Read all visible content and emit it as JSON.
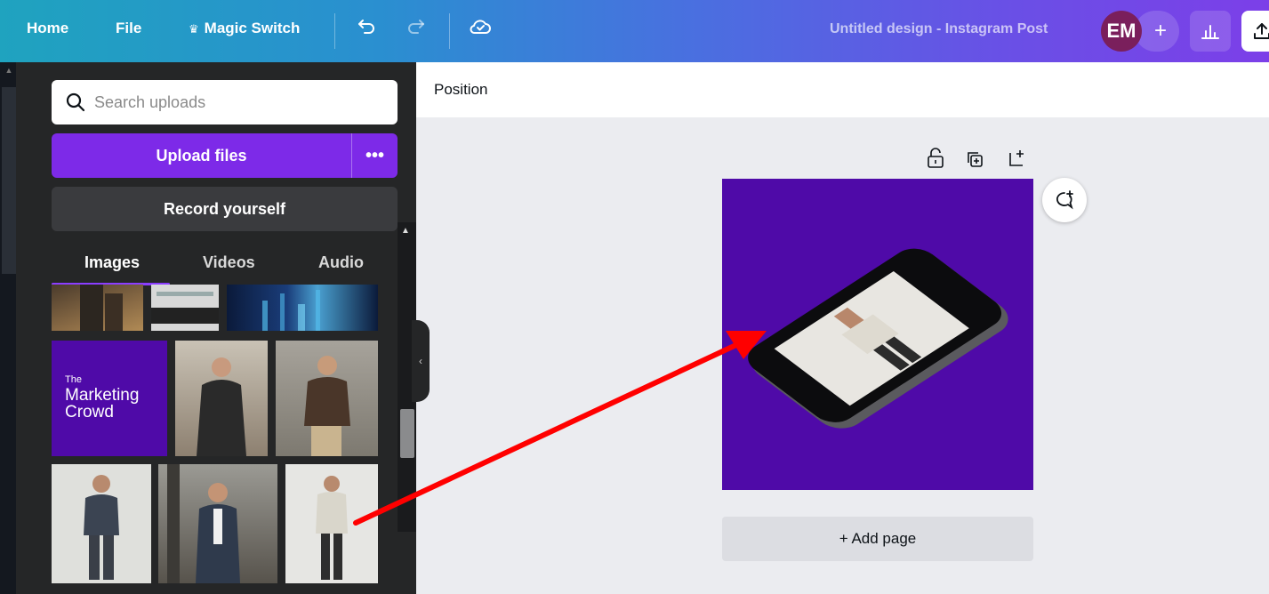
{
  "topbar": {
    "home": "Home",
    "file": "File",
    "magic_switch": "Magic Switch",
    "magic_icon": "crown-icon",
    "undo_icon": "undo-icon",
    "redo_icon": "redo-icon",
    "cloud_icon": "cloud-saved-icon",
    "design_title": "Untitled design - Instagram Post",
    "avatar_initials": "EM",
    "avatar_add": "+"
  },
  "panel": {
    "search_placeholder": "Search uploads",
    "upload_label": "Upload files",
    "upload_more": "•••",
    "record_label": "Record yourself",
    "tabs": [
      {
        "label": "Images",
        "active": true
      },
      {
        "label": "Videos",
        "active": false
      },
      {
        "label": "Audio",
        "active": false
      }
    ],
    "marketing_tile": {
      "line1": "The",
      "line2": "Marketing",
      "line3": "Crowd"
    }
  },
  "editor": {
    "toolbar_label": "Position",
    "add_page": "+ Add page"
  },
  "colors": {
    "accent": "#8b3dff",
    "upload_button": "#7d2ae8",
    "canvas_bg": "#4f0aa8",
    "annotation_arrow": "#ff0000"
  }
}
